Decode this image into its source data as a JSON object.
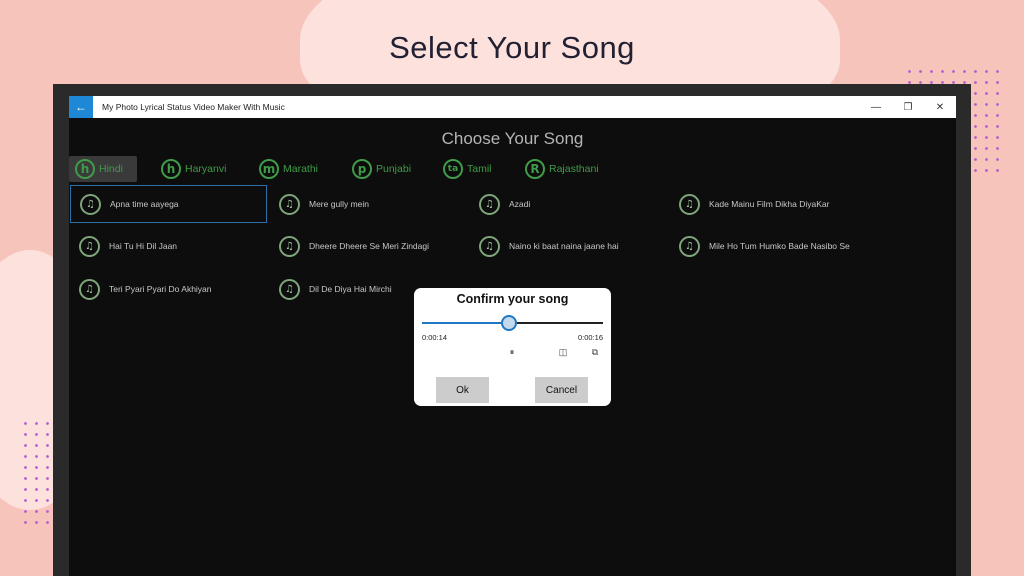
{
  "headline": "Select Your Song",
  "window": {
    "title": "My Photo Lyrical Status Video Maker With Music",
    "back_icon": "←",
    "minimize_icon": "—",
    "restore_icon": "❐",
    "close_icon": "✕"
  },
  "page_title": "Choose Your Song",
  "tabs": [
    {
      "letter": "h",
      "label": "Hindi",
      "active": true
    },
    {
      "letter": "h",
      "label": "Haryanvi",
      "active": false
    },
    {
      "letter": "m",
      "label": "Marathi",
      "active": false
    },
    {
      "letter": "p",
      "label": "Punjabi",
      "active": false
    },
    {
      "letter": "ta",
      "label": "Tamil",
      "active": false
    },
    {
      "letter": "R",
      "label": "Rajasthani",
      "active": false
    }
  ],
  "songs": [
    "Apna time aayega",
    "Mere gully mein",
    "Azadi",
    "Kade Mainu Film Dikha DiyaKar",
    "Hai Tu Hi Dil Jaan",
    "Dheere Dheere Se Meri Zindagi",
    "Naino ki baat naina jaane hai",
    "Mile Ho Tum Humko Bade Nasibo Se",
    "Teri Pyari Pyari Do Akhiyan",
    "Dil De Diya Hai Mirchi"
  ],
  "selected_song_index": 0,
  "dialog": {
    "title": "Confirm your song",
    "current_time": "0:00:14",
    "total_time": "0:00:16",
    "progress_fraction": 0.48,
    "pause_icon": "⏸",
    "captions_icon": "◫",
    "cast_icon": "⧉",
    "ok_label": "Ok",
    "cancel_label": "Cancel"
  },
  "colors": {
    "accent_green": "#3f9b47",
    "accent_blue": "#1f78c1",
    "background": "#f7c4bb"
  }
}
